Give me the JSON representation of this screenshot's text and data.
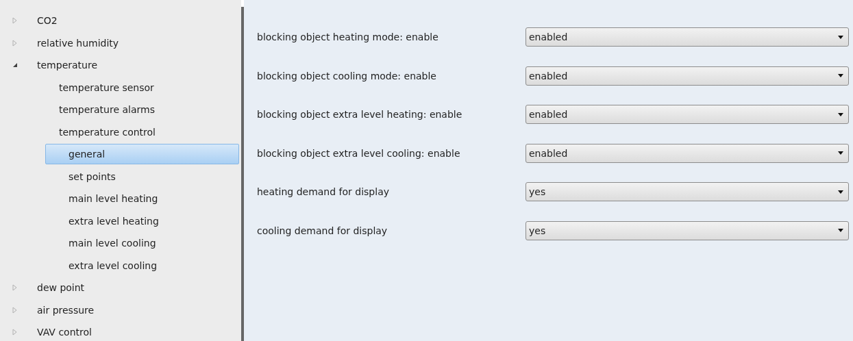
{
  "tree": [
    {
      "label": "CO2",
      "expanded": false,
      "selected": false
    },
    {
      "label": "relative humidity",
      "expanded": false,
      "selected": false
    },
    {
      "label": "temperature",
      "expanded": true,
      "selected": false,
      "children": [
        {
          "label": "temperature sensor",
          "selected": false
        },
        {
          "label": "temperature alarms",
          "selected": false
        },
        {
          "label": "temperature control",
          "selected": false,
          "children": [
            {
              "label": "general",
              "selected": true
            },
            {
              "label": "set points",
              "selected": false
            },
            {
              "label": "main level heating",
              "selected": false
            },
            {
              "label": "extra level heating",
              "selected": false
            },
            {
              "label": "main level cooling",
              "selected": false
            },
            {
              "label": "extra level cooling",
              "selected": false
            }
          ]
        }
      ]
    },
    {
      "label": "dew point",
      "expanded": false,
      "selected": false
    },
    {
      "label": "air pressure",
      "expanded": false,
      "selected": false
    },
    {
      "label": "VAV control",
      "expanded": false,
      "selected": false
    }
  ],
  "settings": [
    {
      "label": "blocking object heating mode: enable",
      "value": "enabled"
    },
    {
      "label": "blocking object cooling mode: enable",
      "value": "enabled"
    },
    {
      "label": "blocking object extra level heating: enable",
      "value": "enabled"
    },
    {
      "label": "blocking object extra level cooling: enable",
      "value": "enabled"
    },
    {
      "label": "heating demand for display",
      "value": "yes"
    },
    {
      "label": "cooling demand for display",
      "value": "yes"
    }
  ]
}
